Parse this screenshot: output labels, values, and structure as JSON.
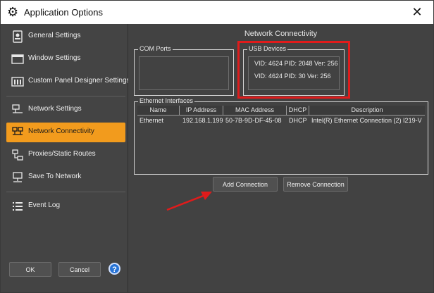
{
  "window": {
    "title": "Application Options",
    "icon": "gear-icon"
  },
  "sidebar": {
    "items": [
      {
        "label": "General Settings",
        "icon": "general-settings-icon"
      },
      {
        "label": "Window Settings",
        "icon": "window-icon"
      },
      {
        "label": "Custom Panel Designer Settings",
        "icon": "panel-designer-icon"
      },
      {
        "label": "Network Settings",
        "icon": "network-settings-icon"
      },
      {
        "label": "Network Connectivity",
        "icon": "network-connectivity-icon",
        "active": true
      },
      {
        "label": "Proxies/Static Routes",
        "icon": "proxies-icon"
      },
      {
        "label": "Save To Network",
        "icon": "save-network-icon"
      },
      {
        "label": "Event Log",
        "icon": "event-log-icon"
      }
    ],
    "ok_label": "OK",
    "cancel_label": "Cancel",
    "help_label": "?"
  },
  "main": {
    "heading": "Network Connectivity",
    "com_ports": {
      "title": "COM Ports"
    },
    "usb_devices": {
      "title": "USB Devices",
      "entries": [
        "VID: 4624 PID: 2048 Ver: 256",
        "VID: 4624 PID: 30 Ver: 256"
      ]
    },
    "ethernet": {
      "title": "Ethernet Interfaces",
      "columns": [
        "Name",
        "IP Address",
        "MAC Address",
        "DHCP",
        "Description"
      ],
      "rows": [
        [
          "Ethernet",
          "192.168.1.199",
          "50-7B-9D-DF-45-08",
          "DHCP",
          "Intel(R) Ethernet Connection (2) I219-V"
        ]
      ]
    },
    "add_connection_label": "Add Connection",
    "remove_connection_label": "Remove Connection"
  },
  "colors": {
    "accent": "#f29b1d",
    "highlight": "#e01b1b",
    "background": "#424242"
  }
}
